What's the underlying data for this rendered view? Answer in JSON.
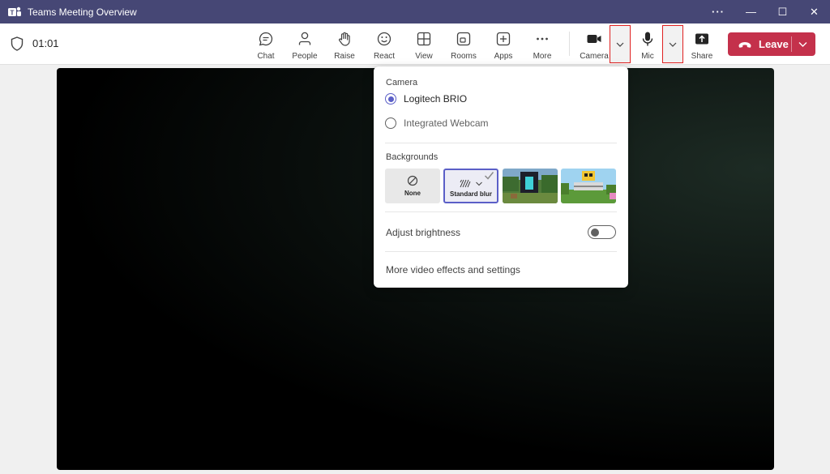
{
  "window": {
    "title": "Teams Meeting Overview",
    "controls": {
      "more": "···",
      "minimize": "—",
      "maximize": "☐",
      "close": "✕"
    }
  },
  "toolbar": {
    "timer": "01:01",
    "buttons": [
      {
        "label": "Chat",
        "icon": "chat-icon"
      },
      {
        "label": "People",
        "icon": "people-icon"
      },
      {
        "label": "Raise",
        "icon": "raise-hand-icon"
      },
      {
        "label": "React",
        "icon": "react-icon"
      },
      {
        "label": "View",
        "icon": "view-icon"
      },
      {
        "label": "Rooms",
        "icon": "rooms-icon"
      },
      {
        "label": "Apps",
        "icon": "apps-icon"
      },
      {
        "label": "More",
        "icon": "more-icon"
      },
      {
        "label": "Camera",
        "icon": "camera-icon"
      },
      {
        "label": "Mic",
        "icon": "mic-icon"
      },
      {
        "label": "Share",
        "icon": "share-icon"
      }
    ],
    "leave_label": "Leave"
  },
  "flyout": {
    "camera_title": "Camera",
    "cameras": [
      {
        "label": "Logitech BRIO",
        "selected": true
      },
      {
        "label": "Integrated Webcam",
        "selected": false
      }
    ],
    "backgrounds_title": "Backgrounds",
    "backgrounds": [
      {
        "label": "None"
      },
      {
        "label": "Standard blur",
        "selected": true
      }
    ],
    "adjust_brightness": "Adjust brightness",
    "brightness_on": false,
    "more_settings": "More video effects and settings"
  },
  "colors": {
    "titlebar": "#464775",
    "accent": "#5b5fc7",
    "leave": "#c4314b",
    "highlight_box": "#e02020"
  }
}
